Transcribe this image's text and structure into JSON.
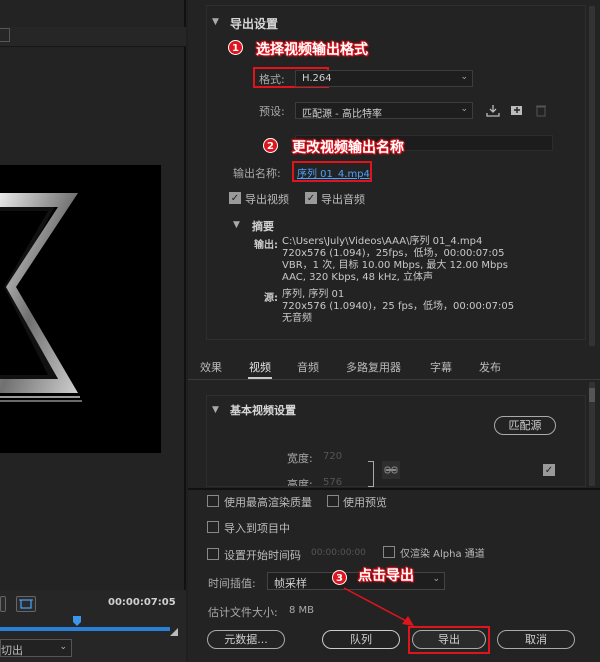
{
  "left": {
    "timecode": "00:00:07:05",
    "source_select": "切出"
  },
  "export_settings": {
    "title": "导出设置",
    "format_label": "格式:",
    "format_value": "H.264",
    "preset_label": "预设:",
    "preset_value": "匹配源 - 高比特率",
    "output_name_label": "输出名称:",
    "output_name_value": "序列 01_4.mp4",
    "export_video": "导出视频",
    "export_audio": "导出音频",
    "summary_title": "摘要",
    "output_label": "输出:",
    "output_lines": [
      "C:\\Users\\July\\Videos\\AAA\\序列 01_4.mp4",
      "720x576 (1.094)，25fps，低场，00:00:07:05",
      "VBR，1 次, 目标 10.00 Mbps, 最大 12.00 Mbps",
      "AAC, 320 Kbps, 48  kHz, 立体声"
    ],
    "source_label": "源:",
    "source_lines": [
      "序列, 序列 01",
      "720x576 (1.0940)，25 fps，低场，00:00:07:05",
      "无音频"
    ]
  },
  "callouts": {
    "c1_num": "1",
    "c1_text": "选择视频输出格式",
    "c2_num": "2",
    "c2_text": "更改视频输出名称",
    "c3_num": "3",
    "c3_text": "点击导出"
  },
  "tabs": [
    "效果",
    "视频",
    "音频",
    "多路复用器",
    "字幕",
    "发布"
  ],
  "video_panel": {
    "title": "基本视频设置",
    "match_source": "匹配源",
    "width_label": "宽度:",
    "width_value": "720",
    "height_label": "高度:",
    "height_value": "576"
  },
  "bottom": {
    "max_render_quality": "使用最高渲染质量",
    "use_previews": "使用预览",
    "import_to_project": "导入到项目中",
    "set_start_timecode": "设置开始时间码",
    "start_timecode_value": "00:00:00:00",
    "render_alpha_only": "仅渲染 Alpha 通道",
    "time_interp_label": "时间插值:",
    "time_interp_value": "帧采样",
    "est_size_label": "估计文件大小:",
    "est_size_value": "8 MB",
    "metadata_button": "元数据...",
    "queue_button": "队列",
    "export_button": "导出",
    "cancel_button": "取消"
  }
}
